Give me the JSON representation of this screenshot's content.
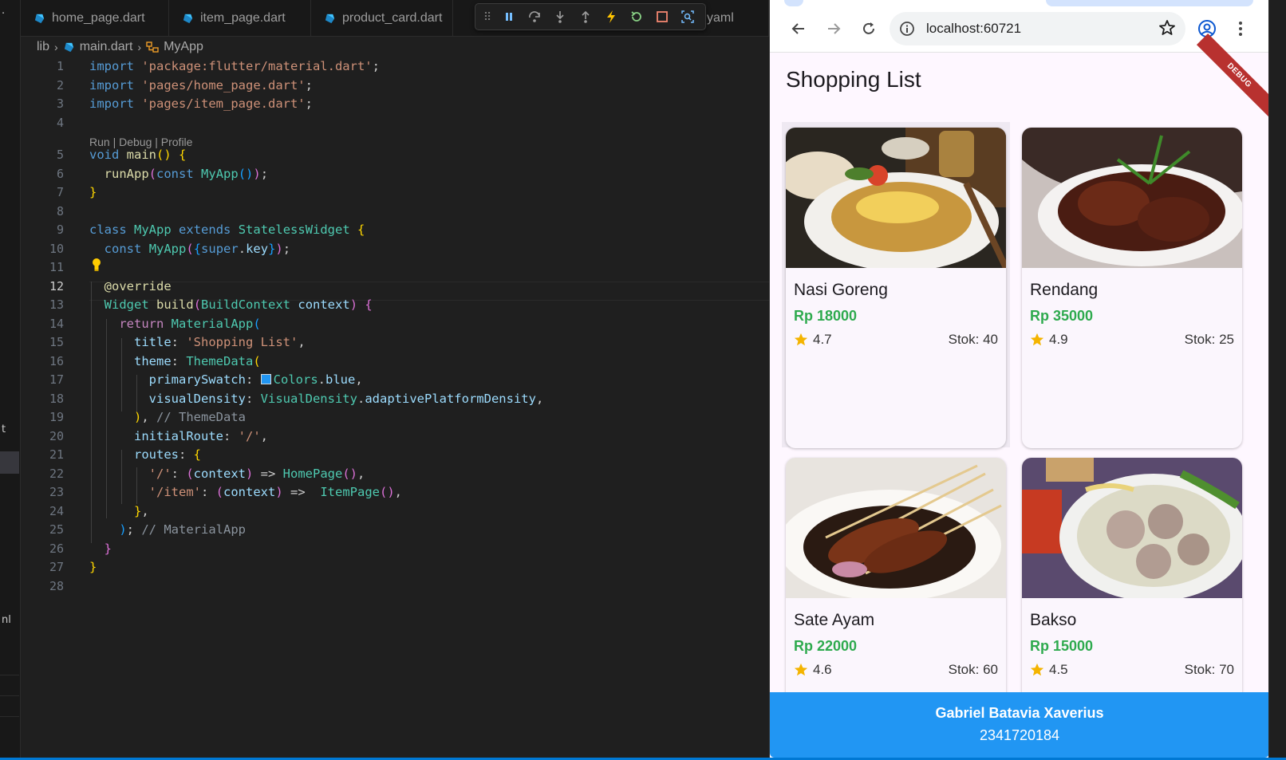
{
  "editor": {
    "tabs": [
      {
        "label": "home_page.dart"
      },
      {
        "label": "item_page.dart"
      },
      {
        "label": "product_card.dart"
      },
      {
        "label": "yaml"
      }
    ],
    "breadcrumb": {
      "folder": "lib",
      "file": "main.dart",
      "symbol": "MyApp"
    },
    "codelens": "Run | Debug | Profile",
    "line_numbers": [
      "1",
      "2",
      "3",
      "4",
      "5",
      "6",
      "7",
      "8",
      "9",
      "10",
      "11",
      "12",
      "13",
      "14",
      "15",
      "16",
      "17",
      "18",
      "19",
      "20",
      "21",
      "22",
      "23",
      "24",
      "25",
      "26",
      "27",
      "28"
    ],
    "active_line": "12",
    "code": {
      "l1": [
        "import",
        " ",
        "'package:flutter/material.dart'",
        ";"
      ],
      "l2": [
        "import",
        " ",
        "'pages/home_page.dart'",
        ";"
      ],
      "l3": [
        "import",
        " ",
        "'pages/item_page.dart'",
        ";"
      ],
      "l5": [
        "void",
        " ",
        "main",
        "()",
        " ",
        "{"
      ],
      "l6": [
        "  ",
        "runApp",
        "(",
        "const",
        " ",
        "MyApp",
        "()",
        ")",
        ";"
      ],
      "l7": [
        "}"
      ],
      "l9": [
        "class",
        " ",
        "MyApp",
        " ",
        "extends",
        " ",
        "StatelessWidget",
        " ",
        "{"
      ],
      "l10": [
        "  ",
        "const",
        " ",
        "MyApp",
        "(",
        "{",
        "super",
        ".",
        "key",
        "}",
        ")",
        ";"
      ],
      "l12": [
        "  ",
        "@override"
      ],
      "l13": [
        "  ",
        "Widget",
        " ",
        "build",
        "(",
        "BuildContext",
        " ",
        "context",
        ")",
        " ",
        "{"
      ],
      "l14": [
        "    ",
        "return",
        " ",
        "MaterialApp",
        "("
      ],
      "l15": [
        "      ",
        "title",
        ": ",
        "'Shopping List'",
        ","
      ],
      "l16": [
        "      ",
        "theme",
        ": ",
        "ThemeData",
        "("
      ],
      "l17": [
        "        ",
        "primarySwatch",
        ": ",
        "Colors",
        ".",
        "blue",
        ","
      ],
      "l18": [
        "        ",
        "visualDensity",
        ": ",
        "VisualDensity",
        ".",
        "adaptivePlatformDensity",
        ","
      ],
      "l19": [
        "      ",
        ")",
        ", ",
        "// ThemeData"
      ],
      "l20": [
        "      ",
        "initialRoute",
        ": ",
        "'/'",
        ","
      ],
      "l21": [
        "      ",
        "routes",
        ": ",
        "{"
      ],
      "l22": [
        "        ",
        "'/'",
        ": ",
        "(",
        "context",
        ")",
        " => ",
        "HomePage",
        "()",
        ","
      ],
      "l23": [
        "        ",
        "'/item'",
        ": ",
        "(",
        "context",
        ")",
        " =>  ",
        "ItemPage",
        "()",
        ","
      ],
      "l24": [
        "      ",
        "}",
        ","
      ],
      "l25": [
        "    ",
        ")",
        "; ",
        "// MaterialApp"
      ],
      "l26": [
        "  ",
        "}"
      ],
      "l27": [
        "}"
      ]
    }
  },
  "browser": {
    "url": "localhost:60721",
    "app_title": "Shopping List",
    "debug_banner": "DEBUG",
    "products": [
      {
        "name": "Nasi Goreng",
        "price": "Rp 18000",
        "rating": "4.7",
        "stock": "Stok: 40"
      },
      {
        "name": "Rendang",
        "price": "Rp 35000",
        "rating": "4.9",
        "stock": "Stok: 25"
      },
      {
        "name": "Sate Ayam",
        "price": "Rp 22000",
        "rating": "4.6",
        "stock": "Stok: 60"
      },
      {
        "name": "Bakso",
        "price": "Rp 15000",
        "rating": "4.5",
        "stock": "Stok: 70"
      }
    ],
    "footer": {
      "name": "Gabriel Batavia Xaverius",
      "nim": "2341720184"
    }
  },
  "side_fragments": {
    "a": "·",
    "b": "t",
    "c": "nl"
  },
  "colors": {
    "accent": "#2196f3",
    "price_green": "#2eaa4e",
    "star": "#f4b400",
    "debug": "#b8312f"
  }
}
